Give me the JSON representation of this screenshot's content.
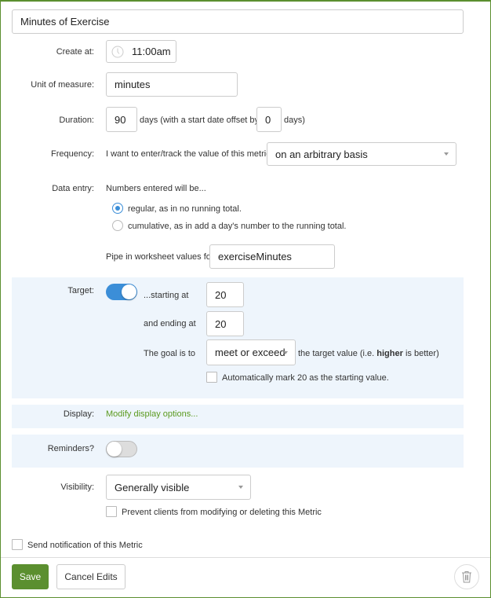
{
  "title_value": "Minutes of Exercise",
  "create_at": {
    "label": "Create at:",
    "value": "11:00am",
    "icon": "clock-icon"
  },
  "unit": {
    "label": "Unit of measure:",
    "value": "minutes"
  },
  "duration": {
    "label": "Duration:",
    "days": "90",
    "text_mid": "days (with a start date offset by",
    "offset": "0",
    "text_end": "days)"
  },
  "frequency": {
    "label": "Frequency:",
    "prefix": "I want to enter/track the value of this metric",
    "selected": "on an arbitrary basis"
  },
  "data_entry": {
    "label": "Data entry:",
    "intro": "Numbers entered will be...",
    "options": [
      {
        "label": "regular, as in no running total.",
        "checked": true
      },
      {
        "label": "cumulative, as in add a day's number to the running total.",
        "checked": false
      }
    ],
    "pipe_label": "Pipe in worksheet values for",
    "pipe_value": "exerciseMinutes"
  },
  "target": {
    "label": "Target:",
    "enabled": true,
    "starting_label": "...starting at",
    "starting_value": "20",
    "ending_label": "and ending at",
    "ending_value": "20",
    "goal_label": "The goal is to",
    "goal_selected": "meet or exceed",
    "goal_suffix_pre": "the target value (i.e. ",
    "goal_suffix_bold": "higher",
    "goal_suffix_post": " is better)",
    "auto_mark_label": "Automatically mark 20 as the starting value.",
    "auto_mark_checked": false
  },
  "display": {
    "label": "Display:",
    "link": "Modify display options..."
  },
  "reminders": {
    "label": "Reminders?",
    "enabled": false
  },
  "visibility": {
    "label": "Visibility:",
    "selected": "Generally visible",
    "prevent_label": "Prevent clients from modifying or deleting this Metric",
    "prevent_checked": false
  },
  "notify": {
    "label": "Send notification of this Metric",
    "checked": false
  },
  "footer": {
    "save": "Save",
    "cancel": "Cancel Edits",
    "delete_icon": "trash-icon"
  },
  "colors": {
    "accent_green": "#5b8f2f",
    "toggle_blue": "#3b8ed8",
    "panel_bg": "#eef5fc",
    "link_green": "#5b9a1f"
  }
}
